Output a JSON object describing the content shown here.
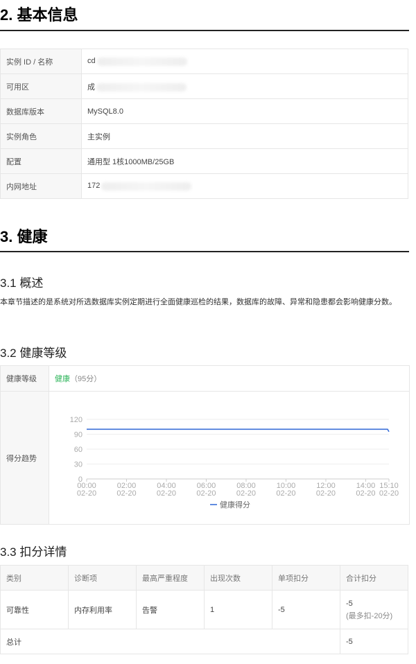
{
  "basic": {
    "title": "2. 基本信息",
    "rows": [
      {
        "key": "实例 ID / 名称",
        "value": "cd",
        "masked": true
      },
      {
        "key": "可用区",
        "value": "成",
        "masked": true
      },
      {
        "key": "数据库版本",
        "value": "MySQL8.0",
        "masked": false
      },
      {
        "key": "实例角色",
        "value": "主实例",
        "masked": false
      },
      {
        "key": "配置",
        "value": "通用型 1核1000MB/25GB",
        "masked": false
      },
      {
        "key": "内网地址",
        "value": "172",
        "masked": true
      }
    ]
  },
  "health": {
    "title": "3. 健康",
    "overview_title": "3.1 概述",
    "overview_text": "本章节描述的是系统对所选数据库实例定期进行全面健康巡检的结果，数据库的故障、异常和隐患都会影响健康分数。",
    "level_title": "3.2 健康等级",
    "level_label": "健康等级",
    "level_value": "健康",
    "level_score": "（95分）",
    "trend_label": "得分趋势"
  },
  "chart_data": {
    "type": "line",
    "x": [
      "00:00 02-20",
      "02:00 02-20",
      "04:00 02-20",
      "06:00 02-20",
      "08:00 02-20",
      "10:00 02-20",
      "12:00 02-20",
      "14:00 02-20",
      "15:10 02-20"
    ],
    "series": [
      {
        "name": "健康得分",
        "values": [
          100,
          100,
          100,
          100,
          100,
          100,
          100,
          100,
          95
        ]
      }
    ],
    "ylim": [
      0,
      120
    ],
    "yticks": [
      0,
      30,
      60,
      90,
      120
    ],
    "grid": true,
    "legend": "bottom",
    "color": "#3a6fd8"
  },
  "deduction": {
    "title": "3.3 扣分详情",
    "headers": [
      "类别",
      "诊断项",
      "最高严重程度",
      "出现次数",
      "单项扣分",
      "合计扣分"
    ],
    "row": {
      "category": "可靠性",
      "item": "内存利用率",
      "severity": "告警",
      "count": "1",
      "single": "-5",
      "total": "-5",
      "total_note": "(最多扣-20分)"
    },
    "sum_label": "总计",
    "sum_value": "-5"
  }
}
